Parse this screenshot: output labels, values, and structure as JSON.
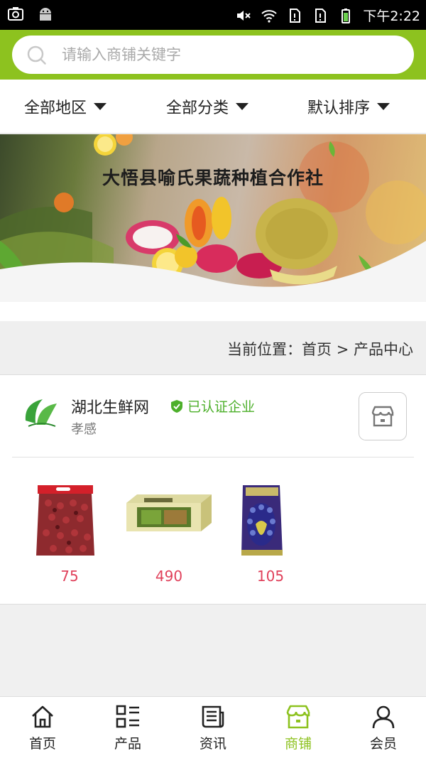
{
  "status_bar": {
    "time": "下午2:22",
    "left_icons": [
      "screenshot-icon",
      "android-icon"
    ],
    "right_icons": [
      "mute-icon",
      "wifi-icon",
      "sim-icon",
      "sim-icon",
      "battery-icon"
    ]
  },
  "search": {
    "placeholder": "请输入商铺关键字",
    "value": "",
    "icon": "search-icon"
  },
  "filters": {
    "region": "全部地区",
    "category": "全部分类",
    "sort": "默认排序"
  },
  "banner": {
    "title": "大悟县喻氏果蔬种植合作社"
  },
  "breadcrumb": {
    "text": "当前位置：首页 > 产品中心"
  },
  "shop": {
    "name": "湖北生鲜网",
    "verified_label": "已认证企业",
    "city": "孝感",
    "products": [
      {
        "price": "75",
        "image": "red-dates-bag"
      },
      {
        "price": "490",
        "image": "gift-box"
      },
      {
        "price": "105",
        "image": "rice-bag"
      }
    ]
  },
  "tabbar": {
    "tabs": [
      {
        "label": "首页",
        "icon": "home-icon",
        "active": false
      },
      {
        "label": "产品",
        "icon": "grid-list-icon",
        "active": false
      },
      {
        "label": "资讯",
        "icon": "news-icon",
        "active": false
      },
      {
        "label": "商铺",
        "icon": "store-icon",
        "active": true
      },
      {
        "label": "会员",
        "icon": "user-icon",
        "active": false
      }
    ]
  },
  "colors": {
    "brand_green": "#8dc21f",
    "price_red": "#e0415b",
    "verified_green": "#4caf2a"
  }
}
